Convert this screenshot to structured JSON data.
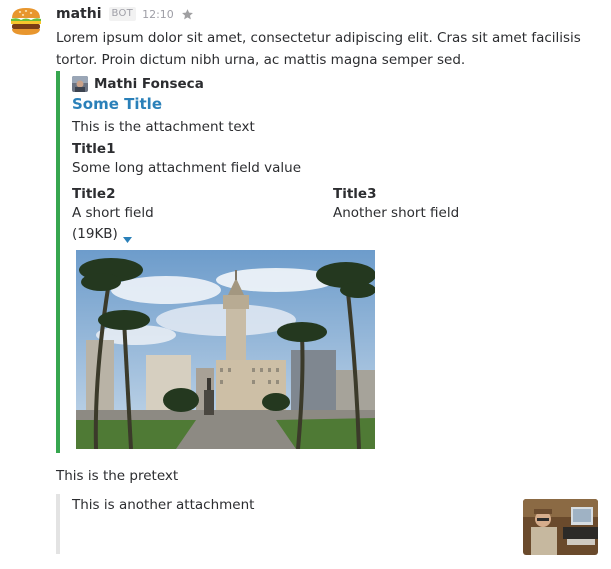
{
  "message": {
    "username": "mathi",
    "badge": "BOT",
    "time": "12:10",
    "text": "Lorem ipsum dolor sit amet, consectetur adipiscing elit. Cras sit amet facilisis tortor. Proin dictum nibh urna, ac mattis magna semper sed.",
    "avatar_icon": "hamburger-icon"
  },
  "attachment1": {
    "color": "#36a64f",
    "author_name": "Mathi Fonseca",
    "title": "Some Title",
    "title_color": "#2a80b9",
    "text": "This is the attachment text",
    "fields": [
      {
        "title": "Title1",
        "value": "Some long attachment field value"
      },
      {
        "title": "Title2",
        "value": "A short field"
      },
      {
        "title": "Title3",
        "value": "Another short field"
      }
    ],
    "size": "(19KB)"
  },
  "pretext": "This is the pretext",
  "attachment2": {
    "color": "#e3e3e3",
    "text": "This is another attachment"
  }
}
